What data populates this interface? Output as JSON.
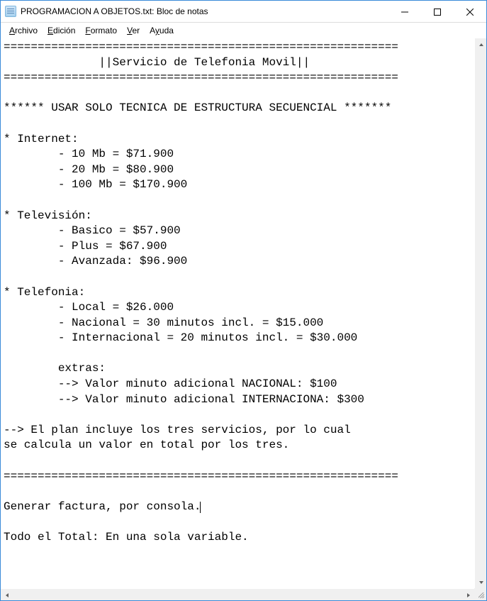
{
  "window": {
    "title": "PROGRAMACION A OBJETOS.txt: Bloc de notas"
  },
  "menu": {
    "archivo": "Archivo",
    "edicion": "Edición",
    "formato": "Formato",
    "ver": "Ver",
    "ayuda": "Ayuda"
  },
  "content": {
    "line1": "==========================================================",
    "line2": "              ||Servicio de Telefonia Movil||",
    "line3": "==========================================================",
    "blank": "",
    "line4": "****** USAR SOLO TECNICA DE ESTRUCTURA SECUENCIAL *******",
    "line5": "* Internet:",
    "line6": "        - 10 Mb = $71.900",
    "line7": "        - 20 Mb = $80.900",
    "line8": "        - 100 Mb = $170.900",
    "line9": "* Televisión:",
    "line10": "        - Basico = $57.900",
    "line11": "        - Plus = $67.900",
    "line12": "        - Avanzada: $96.900",
    "line13": "* Telefonia:",
    "line14": "        - Local = $26.000",
    "line15": "        - Nacional = 30 minutos incl. = $15.000",
    "line16": "        - Internacional = 20 minutos incl. = $30.000",
    "line17": "        extras:",
    "line18": "        --> Valor minuto adicional NACIONAL: $100",
    "line19": "        --> Valor minuto adicional INTERNACIONA: $300",
    "line20": "--> El plan incluye los tres servicios, por lo cual",
    "line21": "se calcula un valor en total por los tres.",
    "line22": "==========================================================",
    "line23a": "Generar factura, por consola.",
    "line24": "Todo el Total: En una sola variable."
  }
}
